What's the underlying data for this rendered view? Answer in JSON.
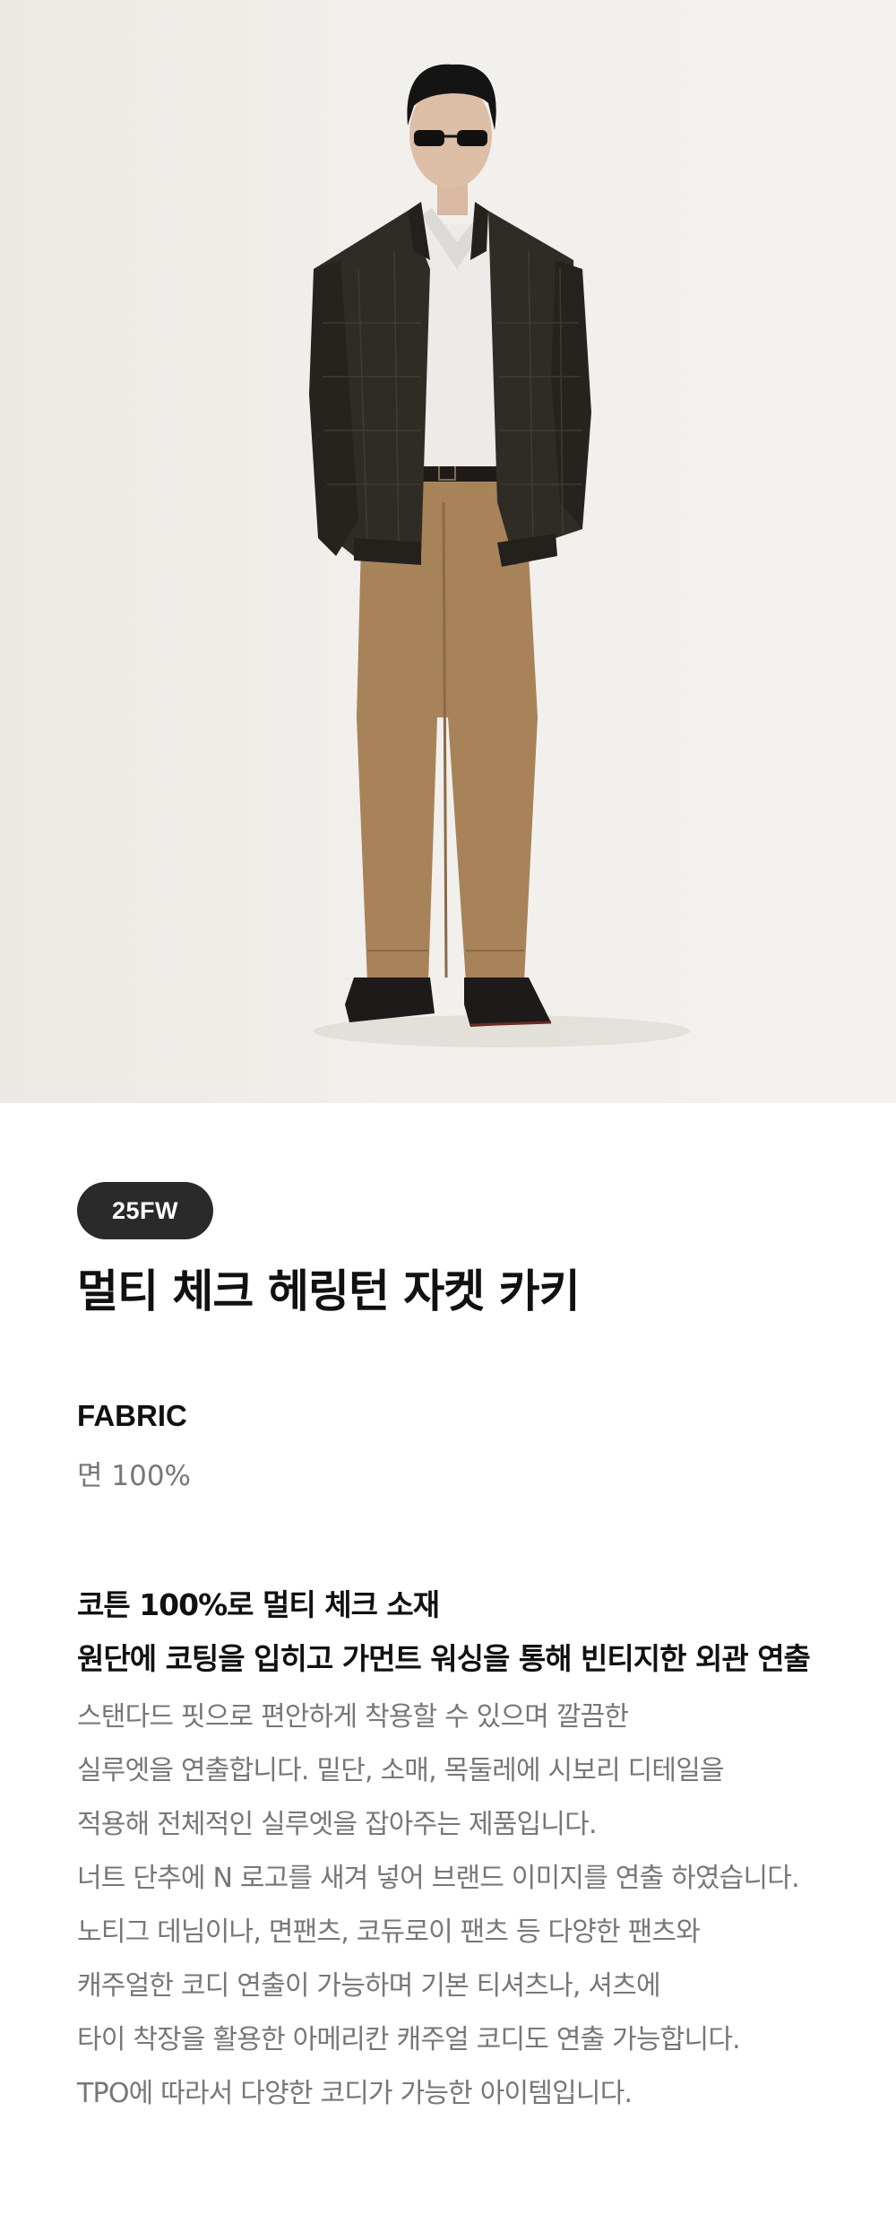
{
  "hero": {
    "image_alt": "model wearing multi check herringbone jacket in khaki",
    "colors": {
      "background": "#efece8",
      "jacket": "#2f2c25",
      "shirt": "#ecebe8",
      "pants": "#a88259",
      "shoes": "#1d1a19",
      "hair": "#141414"
    }
  },
  "product": {
    "season_badge": "25FW",
    "title": "멀티 체크 헤링턴 자켓 카키"
  },
  "fabric": {
    "label": "FABRIC",
    "value": "면 100%"
  },
  "description": {
    "heading": [
      "코튼 100%로 멀티 체크 소재",
      "원단에 코팅을 입히고 가먼트 워싱을 통해 빈티지한 외관 연출"
    ],
    "body": [
      "스탠다드 핏으로 편안하게 착용할 수 있으며 깔끔한",
      "실루엣을 연출합니다. 밑단, 소매, 목둘레에 시보리 디테일을",
      "적용해 전체적인 실루엣을 잡아주는 제품입니다.",
      "너트 단추에 N 로고를 새겨 넣어 브랜드 이미지를 연출 하였습니다.",
      "노티그 데님이나, 면팬츠, 코듀로이 팬츠 등 다양한 팬츠와",
      "캐주얼한 코디 연출이 가능하며 기본 티셔츠나, 셔츠에",
      "타이 착장을 활용한 아메리칸 캐주얼 코디도 연출 가능합니다.",
      "TPO에 따라서 다양한 코디가 가능한 아이템입니다."
    ]
  }
}
